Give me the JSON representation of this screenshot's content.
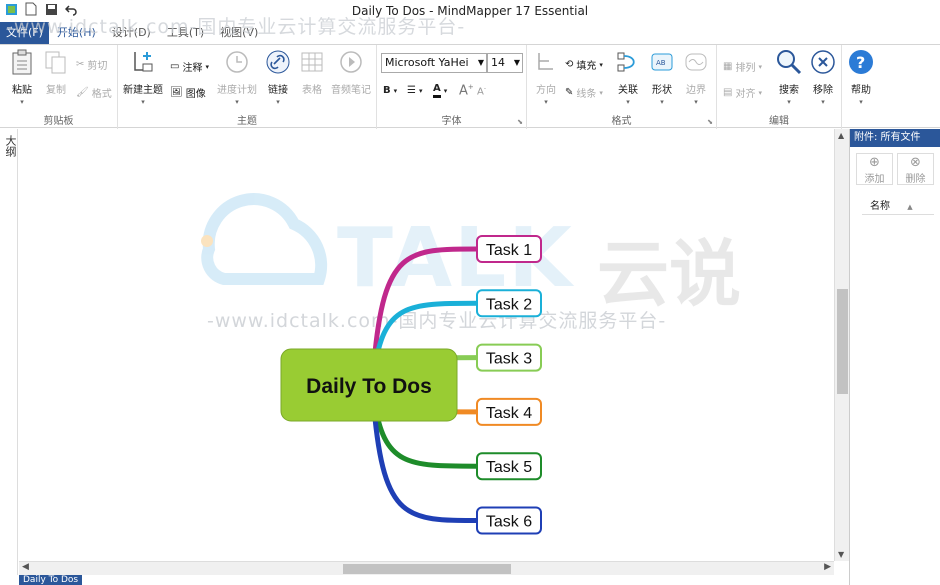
{
  "title_bar": {
    "app_title": "Daily To Dos - MindMapper 17 Essential",
    "quick_access": [
      "app-icon",
      "new-icon",
      "save-icon",
      "undo-icon"
    ]
  },
  "menu_tabs": [
    {
      "label": "文件(F)",
      "kind": "file"
    },
    {
      "label": "开始(H)",
      "kind": "active"
    },
    {
      "label": "设计(D)",
      "kind": "normal"
    },
    {
      "label": "工具(T)",
      "kind": "normal"
    },
    {
      "label": "视图(V)",
      "kind": "normal"
    }
  ],
  "ribbon": {
    "clipboard": {
      "label": "剪贴板",
      "paste": "粘贴",
      "copy": "复制",
      "cut": "剪切",
      "format": "格式"
    },
    "topic": {
      "label": "主题",
      "new_topic": "新建主题",
      "note": "注释",
      "image": "图像",
      "progress": "进度计划",
      "link": "链接",
      "table": "表格",
      "audio_note": "音频笔记"
    },
    "font": {
      "label": "字体",
      "family": "Microsoft YaHei",
      "size": "14"
    },
    "format": {
      "label": "格式",
      "direction": "方向",
      "fill": "填充",
      "line": "线条",
      "relation": "关联",
      "shape": "形状",
      "border": "边界"
    },
    "edit": {
      "label": "编辑",
      "arrange": "排列",
      "align": "对齐",
      "search": "搜索",
      "remove": "移除"
    },
    "help": {
      "label": "帮助"
    }
  },
  "outline": {
    "label": "大纲"
  },
  "mind_map": {
    "central_topic": "Daily To Dos",
    "central_color": "#99cc33",
    "tasks": [
      {
        "label": "Task 1",
        "color": "#c0288c"
      },
      {
        "label": "Task 2",
        "color": "#1ab0d8"
      },
      {
        "label": "Task 3",
        "color": "#88cc55"
      },
      {
        "label": "Task 4",
        "color": "#f08a24"
      },
      {
        "label": "Task 5",
        "color": "#1e8c2a"
      },
      {
        "label": "Task 6",
        "color": "#1f3fb5"
      }
    ]
  },
  "watermark": {
    "brand": "TALK",
    "brand_cn": "云说",
    "text": "-www.idctalk.com-国内专业云计算交流服务平台-"
  },
  "attachments_panel": {
    "title": "附件: 所有文件",
    "add": "添加",
    "delete": "删除",
    "column_name": "名称"
  },
  "doc_tab": "Daily To Dos",
  "colors": {
    "accent": "#2b579a"
  }
}
